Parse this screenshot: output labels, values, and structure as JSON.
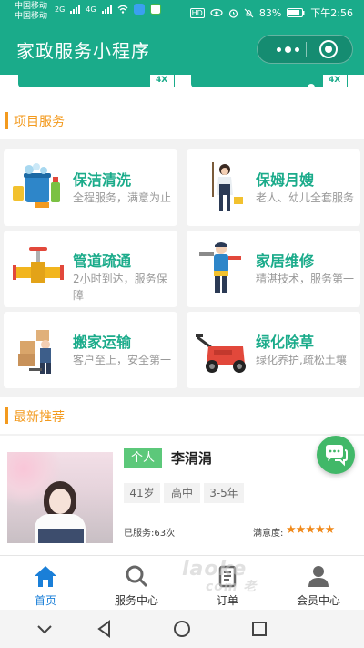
{
  "status_bar": {
    "carrier_1": "中国移动",
    "carrier_2": "中国移动",
    "network_1": "2G",
    "network_2": "4G",
    "hd_label": "HD",
    "battery": "83%",
    "time": "下午2:56"
  },
  "title_bar": {
    "title": "家政服务小程序"
  },
  "coupons": [
    {
      "label": "4X"
    },
    {
      "label": "4X"
    }
  ],
  "services_section": {
    "title": "项目服务"
  },
  "services": [
    {
      "name": "保洁清洗",
      "desc": "全程服务，满意为止",
      "icon": "cleaning-bucket-icon"
    },
    {
      "name": "保姆月嫂",
      "desc": "老人、幼儿全套服务",
      "icon": "nanny-icon"
    },
    {
      "name": "管道疏通",
      "desc": "2小时到达，服务保障",
      "icon": "pipe-icon"
    },
    {
      "name": "家居维修",
      "desc": "精湛技术，服务第一",
      "icon": "repairman-icon"
    },
    {
      "name": "搬家运输",
      "desc": "客户至上，安全第一",
      "icon": "mover-icon"
    },
    {
      "name": "绿化除草",
      "desc": "绿化养护,疏松土壤",
      "icon": "lawn-mower-icon"
    }
  ],
  "recommend_section": {
    "title": "最新推荐"
  },
  "recommend": {
    "type_badge": "个人",
    "name": "李涓涓",
    "tags": [
      "41岁",
      "高中",
      "3-5年"
    ],
    "served": "已服务:63次",
    "satisfaction_label": "满意度:",
    "stars": "★★★★★",
    "rating": 5
  },
  "tabs": [
    {
      "label": "首页",
      "icon": "home-icon",
      "active": true
    },
    {
      "label": "服务中心",
      "icon": "search-icon",
      "active": false
    },
    {
      "label": "订单",
      "icon": "order-icon",
      "active": false
    },
    {
      "label": "会员中心",
      "icon": "user-icon",
      "active": false
    }
  ],
  "watermark": {
    "line1": "laoke",
    "line2": "com 老"
  },
  "colors": {
    "brand": "#1aab8a",
    "accent": "#f39a1e",
    "active_tab": "#1a7fd8"
  }
}
